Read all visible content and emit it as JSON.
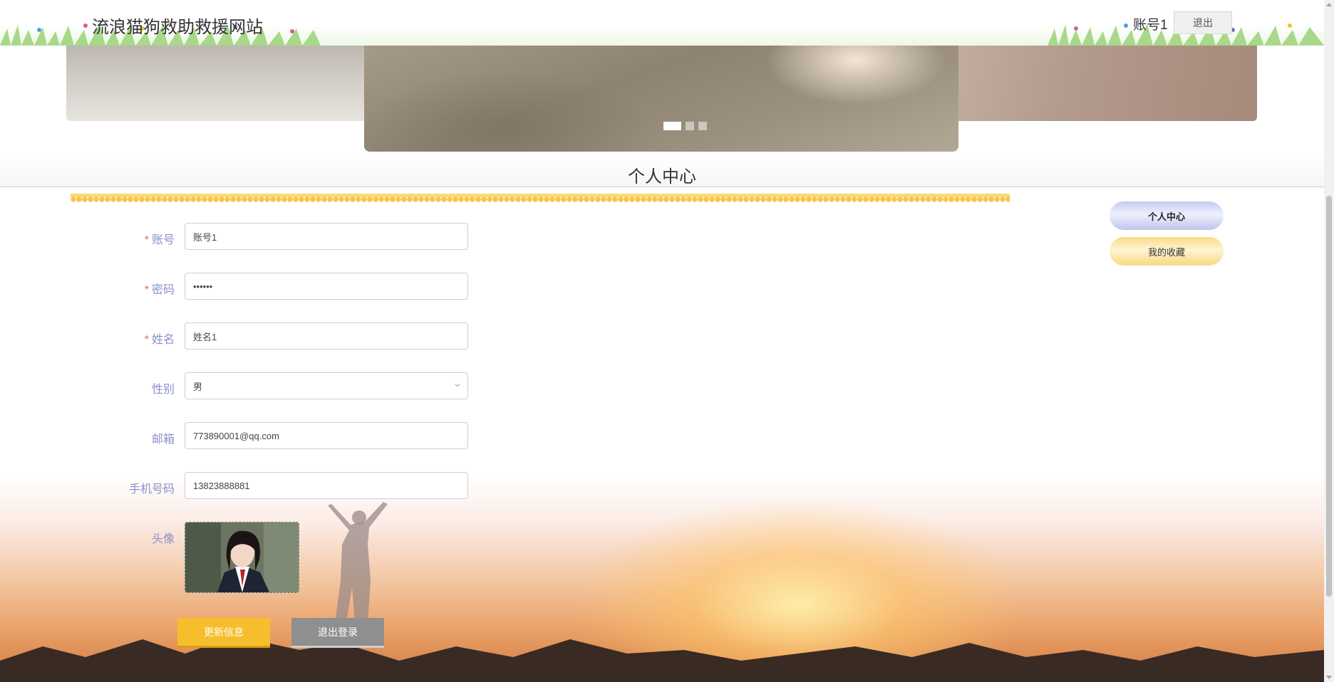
{
  "header": {
    "site_title": "流浪猫狗救助救援网站",
    "user_name": "账号1",
    "logout_label": "退出"
  },
  "carousel": {
    "slide_count": 3,
    "active_index": 0
  },
  "section": {
    "title": "个人中心"
  },
  "form": {
    "account": {
      "label": "账号",
      "required": "*",
      "value": "账号1"
    },
    "password": {
      "label": "密码",
      "required": "*",
      "value": "••••••"
    },
    "name": {
      "label": "姓名",
      "required": "*",
      "value": "姓名1"
    },
    "gender": {
      "label": "性别",
      "value": "男"
    },
    "email": {
      "label": "邮箱",
      "value": "773890001@qq.com"
    },
    "phone": {
      "label": "手机号码",
      "value": "13823888881"
    },
    "avatar": {
      "label": "头像"
    },
    "update_button": "更新信息",
    "logout_button": "退出登录"
  },
  "side_menu": {
    "items": [
      {
        "label": "个人中心",
        "active": true
      },
      {
        "label": "我的收藏",
        "active": false
      }
    ]
  },
  "colors": {
    "label": "#8a8fcc",
    "required": "#e06a6a",
    "update_button": "#f6be2c",
    "logout_button": "#8f8f8f"
  }
}
